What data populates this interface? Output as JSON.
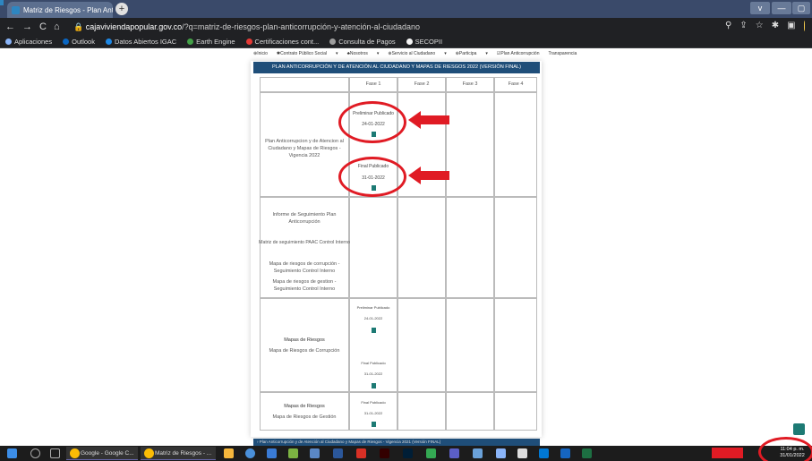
{
  "browser": {
    "tab_title": "Matriz de Riesgos - Plan Antico...",
    "tab_close": "×",
    "new_tab": "+",
    "url_domain": "cajaviviendapopular.gov.co",
    "url_path": "/?q=matriz-de-riesgos-plan-anticorrupción-y-atención-al-ciudadano",
    "nav_back": "←",
    "nav_forward": "→",
    "nav_reload": "C",
    "nav_home": "⌂",
    "icons": [
      "search-icon",
      "share-icon",
      "star-icon",
      "extensions-icon",
      "sidepanel-icon"
    ],
    "icon_glyphs": [
      "⚲",
      "⇪",
      "☆",
      "✱",
      "▣"
    ],
    "window_buttons": [
      "v",
      "—",
      "▢"
    ]
  },
  "bookmarks": [
    {
      "label": "Aplicaciones",
      "color": "#8ab4f8"
    },
    {
      "label": "Outlook",
      "color": "#0a66c2"
    },
    {
      "label": "Datos Abiertos IGAC",
      "color": "#1e88e5"
    },
    {
      "label": "Earth Engine",
      "color": "#43a047"
    },
    {
      "label": "Certificaciones cont...",
      "color": "#e53935"
    },
    {
      "label": "Consulta de Pagos",
      "color": "#9e9e9e"
    },
    {
      "label": "SECOPII",
      "color": "#f5f5f5"
    }
  ],
  "site_nav": [
    "⊕Inicio",
    "✱Contrato Público Social",
    "▾",
    "♣Nosotros",
    "▾",
    "⊕Servicio al Ciudadano",
    "▾",
    "⊕Participa",
    "▾",
    "☑Plan Anticorrupción",
    "Transparencia"
  ],
  "table": {
    "title": "PLAN ANTICORRUPCIÓN Y DE ATENCIÓN AL CIUDADANO Y MAPAS DE RIESGOS 2022 (VERSIÓN FINAL)",
    "headers": [
      "",
      "Fase 1",
      "Fase 2",
      "Fase 3",
      "Fase 4"
    ],
    "row1_label": "Plan Anticorrupcion y de Atencion al Ciudadano y Mapas de Riesgos - Vigencia 2022",
    "row1_prelim": "Preliminar Publicado",
    "row1_prelim_date": "24-01-2022",
    "row1_final": "Final Publicado",
    "row1_final_date": "31-01-2022",
    "row2_items": [
      "Informe de Seguimiento Plan Anticorrupción",
      "Matriz de seguimiento PAAC Control Interno",
      "Mapa de riesgos de corrupción - Seguimiento Control Interno",
      "Mapa de riesgos de gestion - Seguimiento Control Interno"
    ],
    "row3_title": "Mapas de Riesgos",
    "row3_sub": "Mapa de Riesgos de Corrupción",
    "row3_prelim": "Preliminar Publicado",
    "row3_prelim_date": "24-01-2022",
    "row3_final": "Final Publicado",
    "row3_final_date": "31-01-2022",
    "row4_title": "Mapas de Riesgos",
    "row4_sub": "Mapa de Riesgos de Gestión",
    "row4_final": "Final Publicado",
    "row4_final_date": "31-01-2022"
  },
  "bottom_bar": "›  Plan Anticorrupción y de Atención al Ciudadano y Mapas de Riesgos - Vigencia 2021 (Versión FINAL)",
  "taskbar": {
    "apps": [
      "Google - Google C...",
      "Matriz de Riesgos - ..."
    ],
    "time": "11:04 p. m.",
    "date": "31/01/2022"
  },
  "colors": {
    "accent": "#1f4e79",
    "highlight": "#e01b24",
    "doc": "#1d7a74"
  }
}
